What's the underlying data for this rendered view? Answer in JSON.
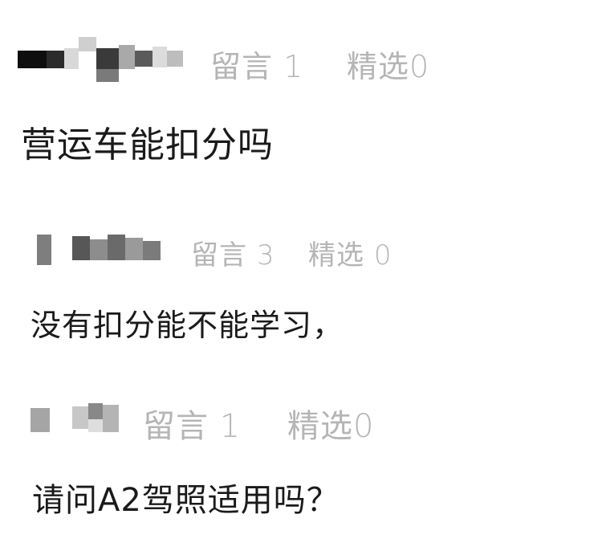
{
  "comments": [
    {
      "stats": {
        "replies_label": "留言",
        "replies_count": "1",
        "picks_label": "精选",
        "picks_count": "0"
      },
      "text": "营运车能扣分吗"
    },
    {
      "stats": {
        "replies_label": "留言",
        "replies_count": "3",
        "picks_label": "精选",
        "picks_count": "0"
      },
      "text": "没有扣分能不能学习，"
    },
    {
      "stats": {
        "replies_label": "留言",
        "replies_count": "1",
        "picks_label": "精选",
        "picks_count": "0"
      },
      "text": "请问A2驾照适用吗？"
    }
  ]
}
